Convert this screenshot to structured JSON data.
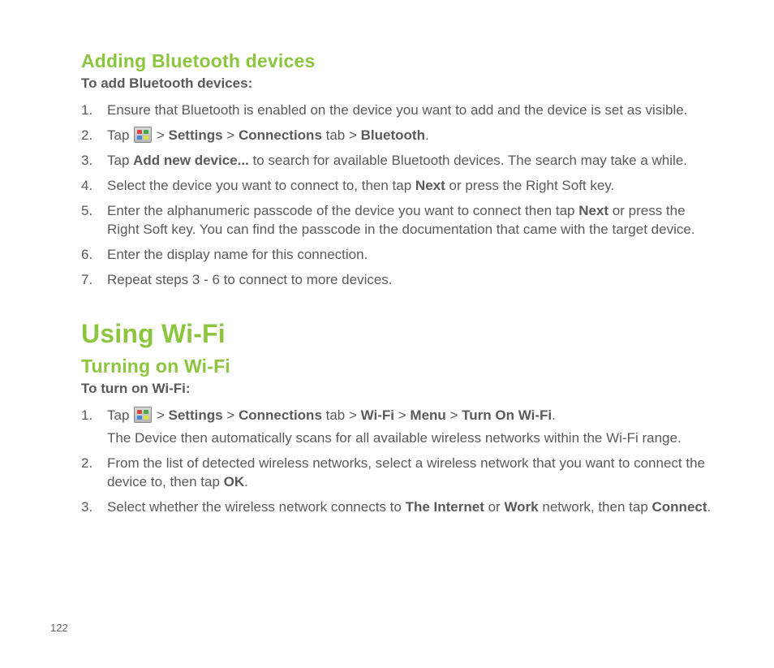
{
  "section_bt": {
    "heading": "Adding Bluetooth devices",
    "intro": "To add Bluetooth devices:",
    "steps": [
      [
        {
          "t": "Ensure that Bluetooth is enabled on the device you want to add and the device is set as visible."
        }
      ],
      [
        {
          "t": "Tap "
        },
        {
          "icon": "start-icon"
        },
        {
          "t": " > "
        },
        {
          "t": "Settings",
          "b": true
        },
        {
          "t": " > "
        },
        {
          "t": "Connections",
          "b": true
        },
        {
          "t": " tab > "
        },
        {
          "t": "Bluetooth",
          "b": true
        },
        {
          "t": "."
        }
      ],
      [
        {
          "t": "Tap "
        },
        {
          "t": "Add new device...",
          "b": true
        },
        {
          "t": " to search for available Bluetooth devices. The search may take a while."
        }
      ],
      [
        {
          "t": "Select the device you want to connect to, then tap "
        },
        {
          "t": "Next",
          "b": true
        },
        {
          "t": " or press the Right Soft key."
        }
      ],
      [
        {
          "t": "Enter the alphanumeric passcode of the device you want to connect then tap "
        },
        {
          "t": "Next",
          "b": true
        },
        {
          "t": " or press the Right Soft key. You can find the passcode in the documentation that came with the target device."
        }
      ],
      [
        {
          "t": "Enter the display name for this connection."
        }
      ],
      [
        {
          "t": "Repeat steps 3 - 6 to connect to more devices."
        }
      ]
    ]
  },
  "section_wifi_title": "Using Wi-Fi",
  "section_wifi": {
    "heading": "Turning on Wi-Fi",
    "intro": "To turn on Wi-Fi:",
    "steps": [
      [
        {
          "t": "Tap "
        },
        {
          "icon": "start-icon"
        },
        {
          "t": " > "
        },
        {
          "t": "Settings",
          "b": true
        },
        {
          "t": " > "
        },
        {
          "t": "Connections",
          "b": true
        },
        {
          "t": " tab > "
        },
        {
          "t": "Wi-Fi",
          "b": true
        },
        {
          "t": " > "
        },
        {
          "t": "Menu",
          "b": true
        },
        {
          "t": " > "
        },
        {
          "t": "Turn On Wi-Fi",
          "b": true
        },
        {
          "t": "."
        },
        {
          "br": true
        },
        {
          "t": "The Device then automatically scans for all available wireless networks within the Wi-Fi range."
        }
      ],
      [
        {
          "t": "From the list of detected wireless networks, select a wireless network that you want to connect the device to, then tap "
        },
        {
          "t": "OK",
          "b": true
        },
        {
          "t": "."
        }
      ],
      [
        {
          "t": "Select whether the wireless network connects to "
        },
        {
          "t": "The Internet",
          "b": true
        },
        {
          "t": " or "
        },
        {
          "t": "Work",
          "b": true
        },
        {
          "t": " network, then tap "
        },
        {
          "t": "Connect",
          "b": true
        },
        {
          "t": "."
        }
      ]
    ]
  },
  "page_number": "122"
}
